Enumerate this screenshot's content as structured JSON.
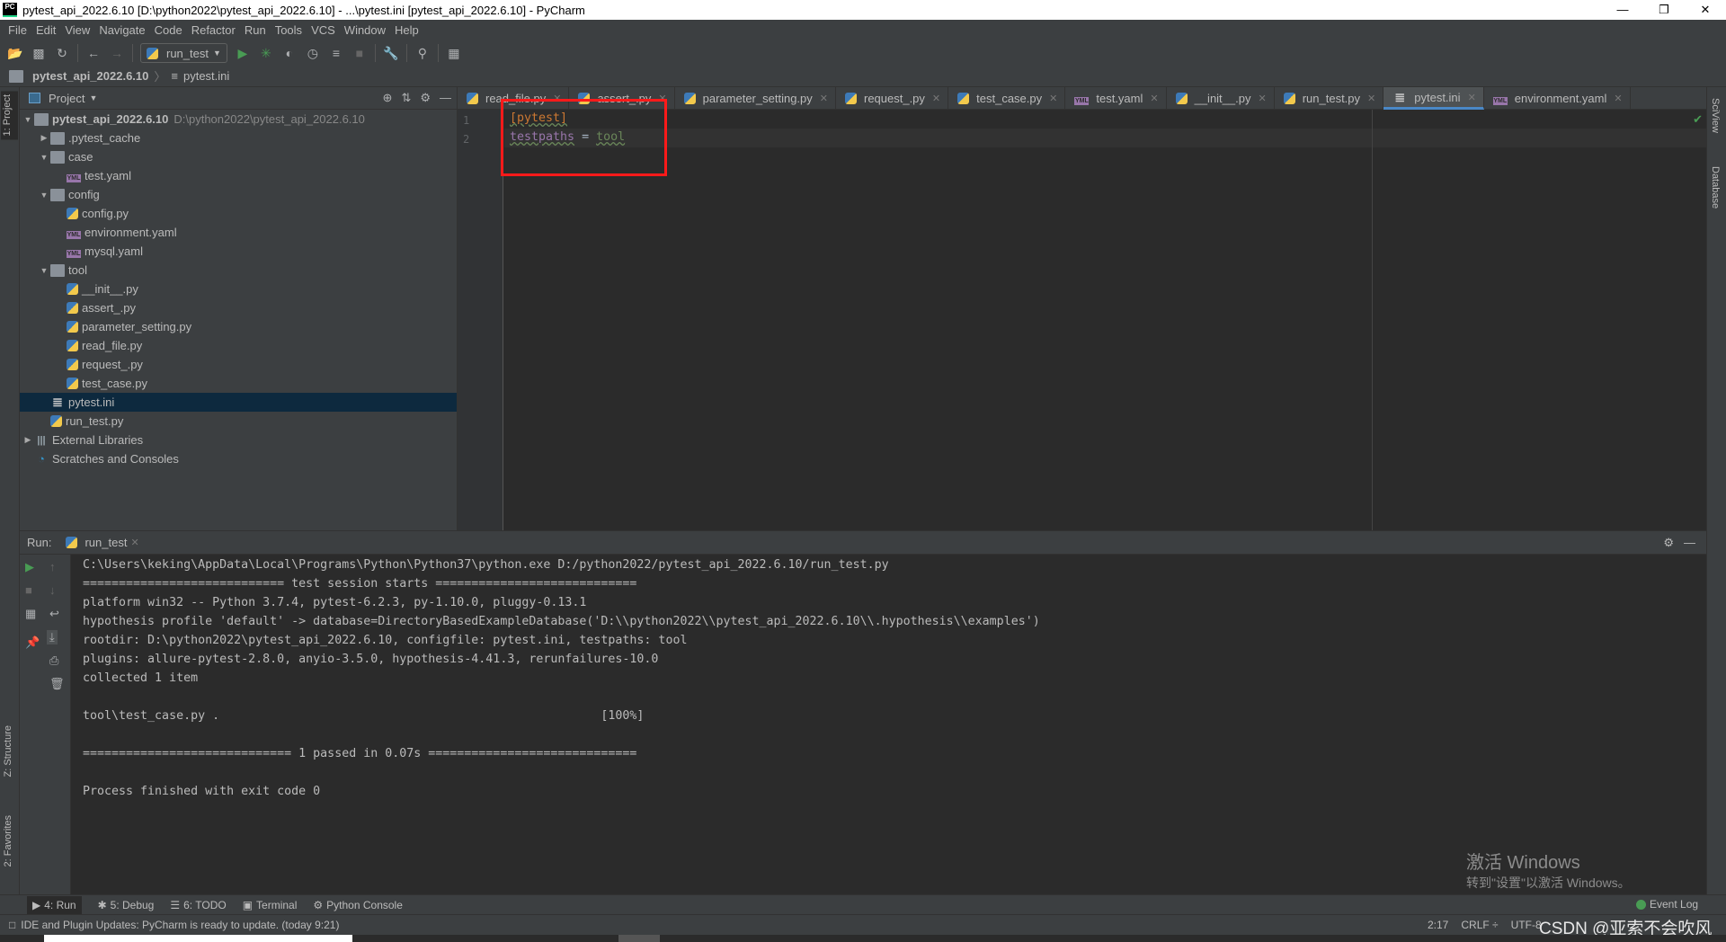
{
  "window": {
    "title": "pytest_api_2022.6.10 [D:\\python2022\\pytest_api_2022.6.10] - ...\\pytest.ini [pytest_api_2022.6.10] - PyCharm",
    "logo": "PC"
  },
  "menu": [
    "File",
    "Edit",
    "View",
    "Navigate",
    "Code",
    "Refactor",
    "Run",
    "Tools",
    "VCS",
    "Window",
    "Help"
  ],
  "toolbar": {
    "run_config": "run_test"
  },
  "breadcrumb": {
    "project": "pytest_api_2022.6.10",
    "file": "pytest.ini"
  },
  "left_stripe": {
    "project": "1: Project",
    "structure": "Z: Structure",
    "favorites": "2: Favorites"
  },
  "right_stripe": {
    "sciview": "SciView",
    "database": "Database"
  },
  "project": {
    "title": "Project",
    "tree": [
      {
        "label": "pytest_api_2022.6.10",
        "path": "D:\\python2022\\pytest_api_2022.6.10",
        "depth": 0,
        "arrow": "down",
        "icon": "folder",
        "bold": true
      },
      {
        "label": ".pytest_cache",
        "depth": 1,
        "arrow": "right",
        "icon": "folder"
      },
      {
        "label": "case",
        "depth": 1,
        "arrow": "down",
        "icon": "folder"
      },
      {
        "label": "test.yaml",
        "depth": 2,
        "icon": "yml"
      },
      {
        "label": "config",
        "depth": 1,
        "arrow": "down",
        "icon": "folder"
      },
      {
        "label": "config.py",
        "depth": 2,
        "icon": "py"
      },
      {
        "label": "environment.yaml",
        "depth": 2,
        "icon": "yml"
      },
      {
        "label": "mysql.yaml",
        "depth": 2,
        "icon": "yml"
      },
      {
        "label": "tool",
        "depth": 1,
        "arrow": "down",
        "icon": "folder"
      },
      {
        "label": "__init__.py",
        "depth": 2,
        "icon": "py"
      },
      {
        "label": "assert_.py",
        "depth": 2,
        "icon": "py"
      },
      {
        "label": "parameter_setting.py",
        "depth": 2,
        "icon": "py"
      },
      {
        "label": "read_file.py",
        "depth": 2,
        "icon": "py"
      },
      {
        "label": "request_.py",
        "depth": 2,
        "icon": "py"
      },
      {
        "label": "test_case.py",
        "depth": 2,
        "icon": "py"
      },
      {
        "label": "pytest.ini",
        "depth": 1,
        "icon": "ini",
        "selected": true
      },
      {
        "label": "run_test.py",
        "depth": 1,
        "icon": "py"
      },
      {
        "label": "External Libraries",
        "depth": 0,
        "arrow": "right",
        "icon": "lib"
      },
      {
        "label": "Scratches and Consoles",
        "depth": 0,
        "icon": "scratch"
      }
    ]
  },
  "editor": {
    "tabs": [
      {
        "label": "read_file.py",
        "icon": "py"
      },
      {
        "label": "assert_.py",
        "icon": "py"
      },
      {
        "label": "parameter_setting.py",
        "icon": "py"
      },
      {
        "label": "request_.py",
        "icon": "py"
      },
      {
        "label": "test_case.py",
        "icon": "py"
      },
      {
        "label": "test.yaml",
        "icon": "yml"
      },
      {
        "label": "__init__.py",
        "icon": "py"
      },
      {
        "label": "run_test.py",
        "icon": "py"
      },
      {
        "label": "pytest.ini",
        "icon": "ini",
        "active": true
      },
      {
        "label": "environment.yaml",
        "icon": "yml"
      }
    ],
    "lines": [
      {
        "num": "1",
        "section": "[pytest]"
      },
      {
        "num": "2",
        "key": "testpaths",
        "eq": " = ",
        "value": "tool"
      }
    ],
    "colors": {
      "section": "#cc7832",
      "key": "#9876aa",
      "value": "#6a8759",
      "highlight": "#ff1a1a"
    }
  },
  "run": {
    "label": "Run:",
    "tab": "run_test",
    "output": [
      "C:\\Users\\keking\\AppData\\Local\\Programs\\Python\\Python37\\python.exe D:/python2022/pytest_api_2022.6.10/run_test.py",
      "============================ test session starts ============================",
      "platform win32 -- Python 3.7.4, pytest-6.2.3, py-1.10.0, pluggy-0.13.1",
      "hypothesis profile 'default' -> database=DirectoryBasedExampleDatabase('D:\\\\python2022\\\\pytest_api_2022.6.10\\\\.hypothesis\\\\examples')",
      "rootdir: D:\\python2022\\pytest_api_2022.6.10, configfile: pytest.ini, testpaths: tool",
      "plugins: allure-pytest-2.8.0, anyio-3.5.0, hypothesis-4.41.3, rerunfailures-10.0",
      "collected 1 item",
      "",
      "tool\\test_case.py .                                                     [100%]",
      "",
      "============================= 1 passed in 0.07s =============================",
      "",
      "Process finished with exit code 0"
    ]
  },
  "tool_tabs": [
    "4: Run",
    "5: Debug",
    "6: TODO",
    "Terminal",
    "Python Console"
  ],
  "event_log": "Event Log",
  "status": {
    "message": "IDE and Plugin Updates: PyCharm is ready to update. (today 9:21)",
    "position": "2:17",
    "line_sep": "CRLF ÷",
    "encoding": "UTF-8"
  },
  "watermark": {
    "line1": "激活 Windows",
    "line2": "转到\"设置\"以激活 Windows。",
    "csdn": "CSDN @亚索不会吹风"
  }
}
